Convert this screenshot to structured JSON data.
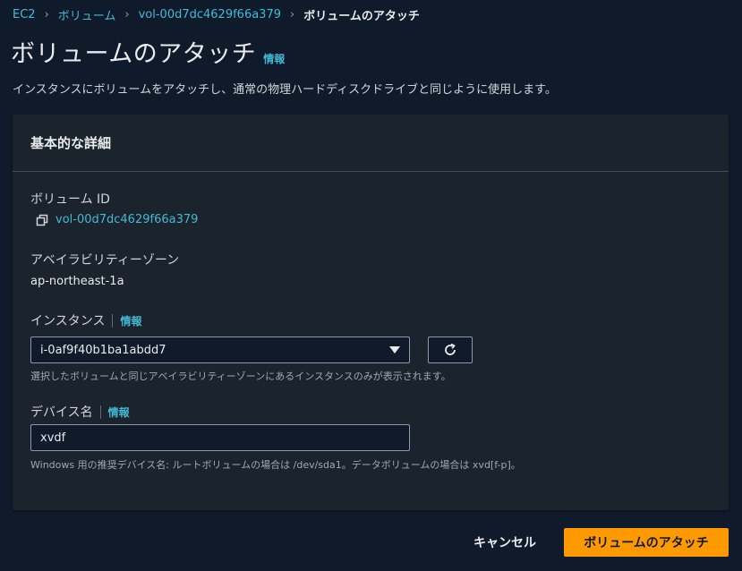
{
  "breadcrumb": {
    "items": [
      "EC2",
      "ボリューム",
      "vol-00d7dc4629f66a379"
    ],
    "current": "ボリュームのアタッチ"
  },
  "header": {
    "title": "ボリュームのアタッチ",
    "info": "情報",
    "description": "インスタンスにボリュームをアタッチし、通常の物理ハードディスクドライブと同じように使用します。"
  },
  "panel": {
    "title": "基本的な詳細",
    "volume_id_label": "ボリューム ID",
    "volume_id_value": "vol-00d7dc4629f66a379",
    "az_label": "アベイラビリティーゾーン",
    "az_value": "ap-northeast-1a",
    "instance_label": "インスタンス",
    "instance_info": "情報",
    "instance_selected": "i-0af9f40b1ba1abdd7",
    "instance_hint": "選択したボリュームと同じアベイラビリティーゾーンにあるインスタンスのみが表示されます。",
    "device_label": "デバイス名",
    "device_info": "情報",
    "device_value": "xvdf",
    "device_hint": "Windows 用の推奨デバイス名: ルートボリュームの場合は /dev/sda1。データボリュームの場合は xvd[f-p]。"
  },
  "footer": {
    "cancel": "キャンセル",
    "submit": "ボリュームのアタッチ"
  },
  "colors": {
    "background": "#0f1b2a",
    "panel": "#1b232d",
    "link": "#44b9d6",
    "primary": "#ff9900"
  },
  "icons": {
    "breadcrumb_separator": "chevron-right-icon",
    "copy": "copy-icon",
    "select_caret": "caret-down-icon",
    "refresh": "refresh-icon"
  }
}
